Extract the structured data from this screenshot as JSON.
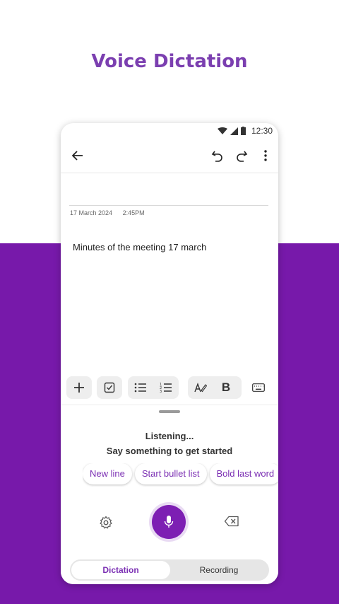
{
  "headline": "Voice Dictation",
  "status": {
    "time": "12:30"
  },
  "note": {
    "date": "17 March 2024",
    "time": "2:45PM",
    "body": "Minutes of the meeting 17 march"
  },
  "toolbar": {
    "bold_label": "B"
  },
  "dictation": {
    "status": "Listening...",
    "hint": "Say something to get started",
    "chips": [
      "New line",
      "Start bullet list",
      "Bold last word"
    ]
  },
  "tabs": [
    {
      "label": "Dictation",
      "active": true
    },
    {
      "label": "Recording",
      "active": false
    }
  ],
  "colors": {
    "brand_purple": "#7719aa",
    "accent": "#7d1fb3"
  }
}
